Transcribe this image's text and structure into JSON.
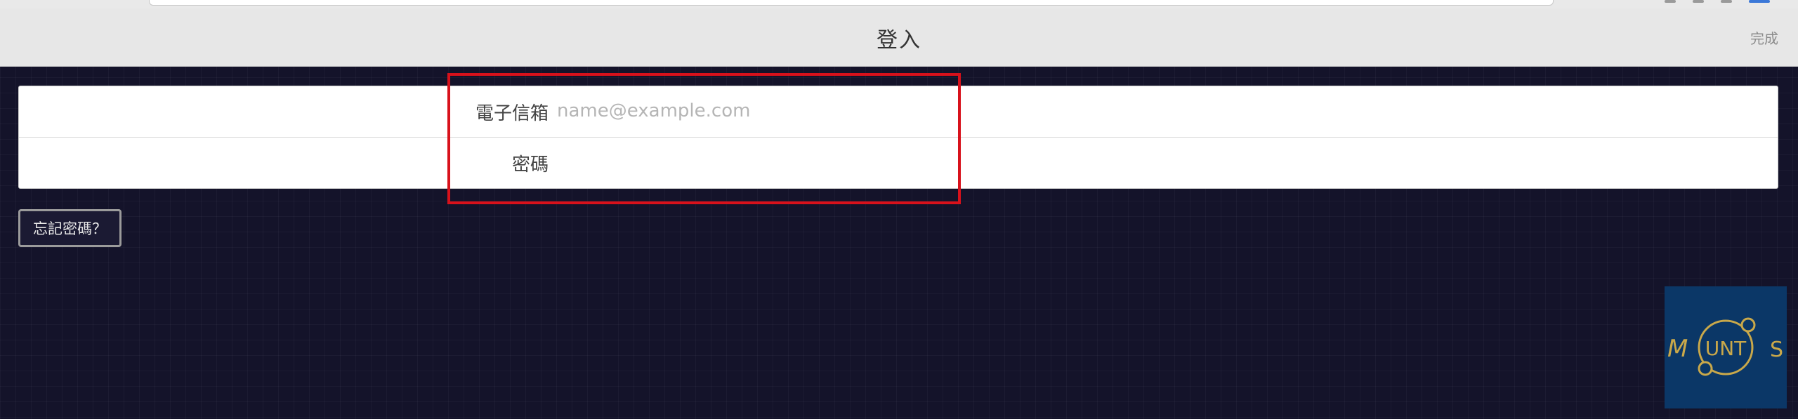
{
  "header": {
    "title": "登入",
    "done_label": "完成"
  },
  "form": {
    "email_label": "電子信箱",
    "email_placeholder": "name@example.com",
    "email_value": "",
    "password_label": "密碼",
    "password_value": ""
  },
  "forgot_password_label": "忘記密碼？",
  "logo": {
    "text_left": "M",
    "text_center": "UNT",
    "text_right": "S",
    "icon": "mounts-logo"
  },
  "colors": {
    "background": "#14132a",
    "header_bg": "#e7e7e7",
    "highlight": "#d8111b",
    "logo_bg": "#0b3767",
    "logo_gold": "#c9a84a"
  }
}
